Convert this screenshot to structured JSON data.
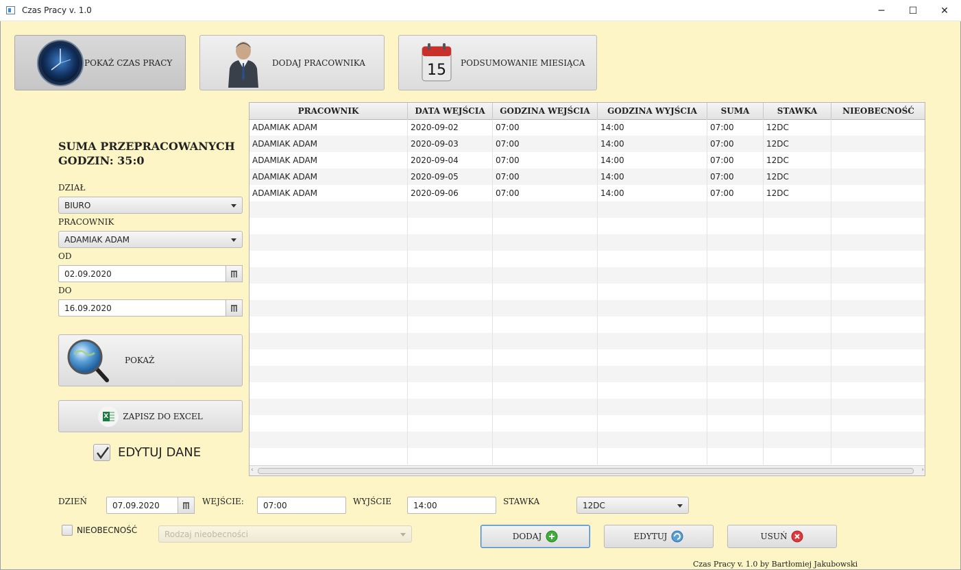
{
  "window": {
    "title": "Czas Pracy v. 1.0",
    "minimize": "─",
    "maximize": "☐",
    "close": "✕"
  },
  "nav": [
    {
      "label": "POKAŻ CZAS PRACY",
      "icon": "clock-icon"
    },
    {
      "label": "DODAJ PRACOWNIKA",
      "icon": "businessman-icon"
    },
    {
      "label": "PODSUMOWANIE MIESIĄCA",
      "icon": "calendar-icon",
      "calendar_day": "15"
    }
  ],
  "summary": {
    "line1": "SUMA PRZEPRACOWANYCH",
    "line2": "GODZIN: 35:0"
  },
  "filters": {
    "dzial_label": "DZIAŁ",
    "dzial_value": "BIURO",
    "pracownik_label": "PRACOWNIK",
    "pracownik_value": "ADAMIAK ADAM",
    "od_label": "OD",
    "od_value": "02.09.2020",
    "do_label": "DO",
    "do_value": "16.09.2020"
  },
  "buttons": {
    "pokaz": "POKAŻ",
    "excel": "ZAPISZ DO EXCEL",
    "excel_icon_text": "X",
    "edytuj_dane": "EDYTUJ DANE",
    "edytuj_checked": true
  },
  "table": {
    "columns": [
      "PRACOWNIK",
      "DATA WEJŚCIA",
      "GODZINA WEJŚCIA",
      "GODZINA WYJŚCIA",
      "SUMA",
      "STAWKA",
      "NIEOBECNOŚĆ"
    ],
    "rows": [
      [
        "ADAMIAK ADAM",
        "2020-09-02",
        "07:00",
        "14:00",
        "07:00",
        "12DC",
        ""
      ],
      [
        "ADAMIAK ADAM",
        "2020-09-03",
        "07:00",
        "14:00",
        "07:00",
        "12DC",
        ""
      ],
      [
        "ADAMIAK ADAM",
        "2020-09-04",
        "07:00",
        "14:00",
        "07:00",
        "12DC",
        ""
      ],
      [
        "ADAMIAK ADAM",
        "2020-09-05",
        "07:00",
        "14:00",
        "07:00",
        "12DC",
        ""
      ],
      [
        "ADAMIAK ADAM",
        "2020-09-06",
        "07:00",
        "14:00",
        "07:00",
        "12DC",
        ""
      ]
    ]
  },
  "form": {
    "dzien_label": "DZIEŃ",
    "dzien_value": "07.09.2020",
    "wejscie_label": "WEJŚCIE:",
    "wejscie_value": "07:00",
    "wyjscie_label": "WYJŚCIE",
    "wyjscie_value": "14:00",
    "stawka_label": "STAWKA",
    "stawka_value": "12DC",
    "nieobecnosc_label": "NIEOBECNOŚĆ",
    "nieobecnosc_placeholder": "Rodzaj nieobecności"
  },
  "actions": {
    "dodaj": "DODAJ",
    "edytuj": "EDYTUJ",
    "usun": "USUŃ"
  },
  "footer": "Czas Pracy v. 1.0 by Bartłomiej Jakubowski"
}
